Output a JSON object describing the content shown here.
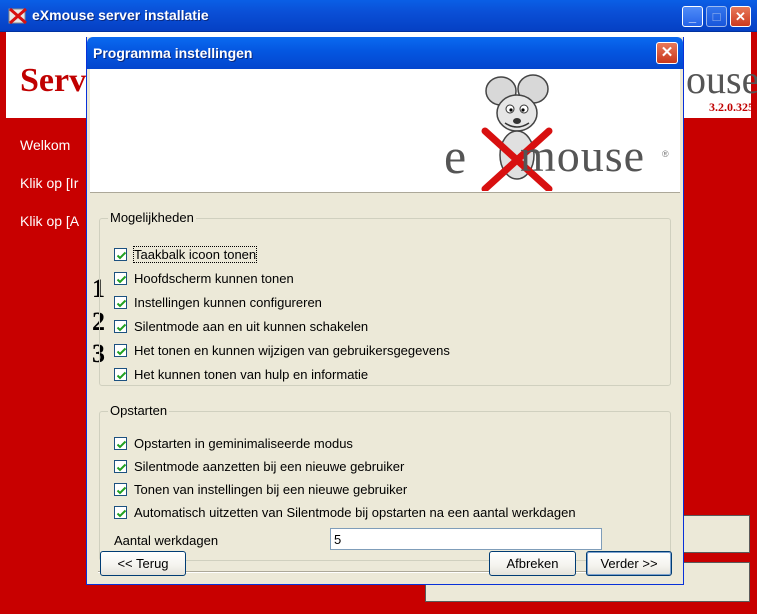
{
  "background_window": {
    "title": "eXmouse server installatie",
    "header_title": "Serv",
    "header_logo_fragment": "ouse",
    "version": "3.2.0.325",
    "lines": [
      "Welkom",
      "Klik op [Ir",
      "Klik op [A"
    ]
  },
  "dialog": {
    "title": "Programma instellingen",
    "close_glyph": "✕",
    "logo": {
      "e": "e",
      "text": "mouse",
      "registered": "®",
      "x_color": "#d81010"
    },
    "groups": {
      "mogelijkheden": {
        "label": "Mogelijkheden",
        "items": [
          {
            "label": "Taakbalk icoon tonen",
            "checked": true
          },
          {
            "label": "Hoofdscherm kunnen tonen",
            "checked": true
          },
          {
            "label": "Instellingen kunnen configureren",
            "checked": true
          },
          {
            "label": "Silentmode aan en uit kunnen schakelen",
            "checked": true
          },
          {
            "label": "Het tonen en kunnen wijzigen van gebruikersgegevens",
            "checked": true
          },
          {
            "label": "Het kunnen tonen van hulp en informatie",
            "checked": true
          }
        ]
      },
      "opstarten": {
        "label": "Opstarten",
        "items": [
          {
            "label": "Opstarten in geminimaliseerde modus",
            "checked": true
          },
          {
            "label": "Silentmode aanzetten bij een nieuwe gebruiker",
            "checked": true
          },
          {
            "label": "Tonen van instellingen bij een nieuwe gebruiker",
            "checked": true
          },
          {
            "label": "Automatisch uitzetten van Silentmode bij opstarten na een aantal werkdagen",
            "checked": true
          }
        ],
        "workdays_label": "Aantal werkdagen",
        "workdays_value": "5"
      }
    },
    "annotations": [
      "1",
      "2",
      "3"
    ],
    "buttons": {
      "back": "<< Terug",
      "cancel": "Afbreken",
      "next": "Verder >>"
    }
  },
  "colors": {
    "background_red": "#c80000",
    "titlebar_blue": "#0456e0",
    "dialog_face": "#ece9d8"
  }
}
